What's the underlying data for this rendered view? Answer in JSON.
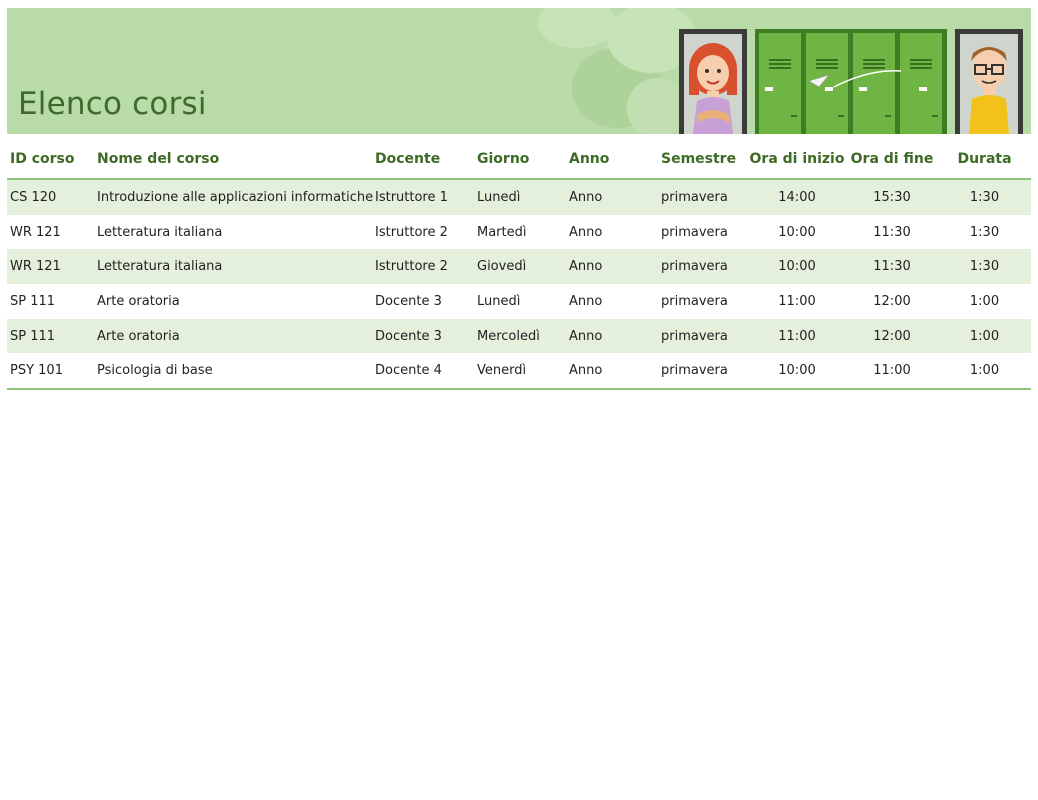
{
  "header": {
    "title": "Elenco corsi"
  },
  "table": {
    "columns": [
      "ID corso",
      "Nome del corso",
      "Docente",
      "Giorno",
      "Anno",
      "Semestre",
      "Ora di inizio",
      "Ora di fine",
      "Durata"
    ],
    "rows": [
      [
        "CS 120",
        "Introduzione alle applicazioni informatiche",
        "Istruttore 1",
        "Lunedì",
        "Anno",
        "primavera",
        "14:00",
        "15:30",
        "1:30"
      ],
      [
        "WR 121",
        "Letteratura italiana",
        "Istruttore 2",
        "Martedì",
        "Anno",
        "primavera",
        "10:00",
        "11:30",
        "1:30"
      ],
      [
        "WR 121",
        "Letteratura italiana",
        "Istruttore 2",
        "Giovedì",
        "Anno",
        "primavera",
        "10:00",
        "11:30",
        "1:30"
      ],
      [
        "SP 111",
        "Arte oratoria",
        "Docente 3",
        "Lunedì",
        "Anno",
        "primavera",
        "11:00",
        "12:00",
        "1:00"
      ],
      [
        "SP 111",
        "Arte oratoria",
        "Docente 3",
        "Mercoledì",
        "Anno",
        "primavera",
        "11:00",
        "12:00",
        "1:00"
      ],
      [
        "PSY 101",
        "Psicologia di base",
        "Docente 4",
        "Venerdì",
        "Anno",
        "primavera",
        "10:00",
        "11:00",
        "1:00"
      ]
    ]
  },
  "colors": {
    "banner": "#b9dba8",
    "accent": "#3d6b25",
    "band": "#e4f0dc",
    "rule": "#8cc47a",
    "locker": "#6fb543"
  },
  "icons": [
    "girl-character-icon",
    "lockers-icon",
    "paper-plane-icon",
    "boy-character-icon"
  ]
}
